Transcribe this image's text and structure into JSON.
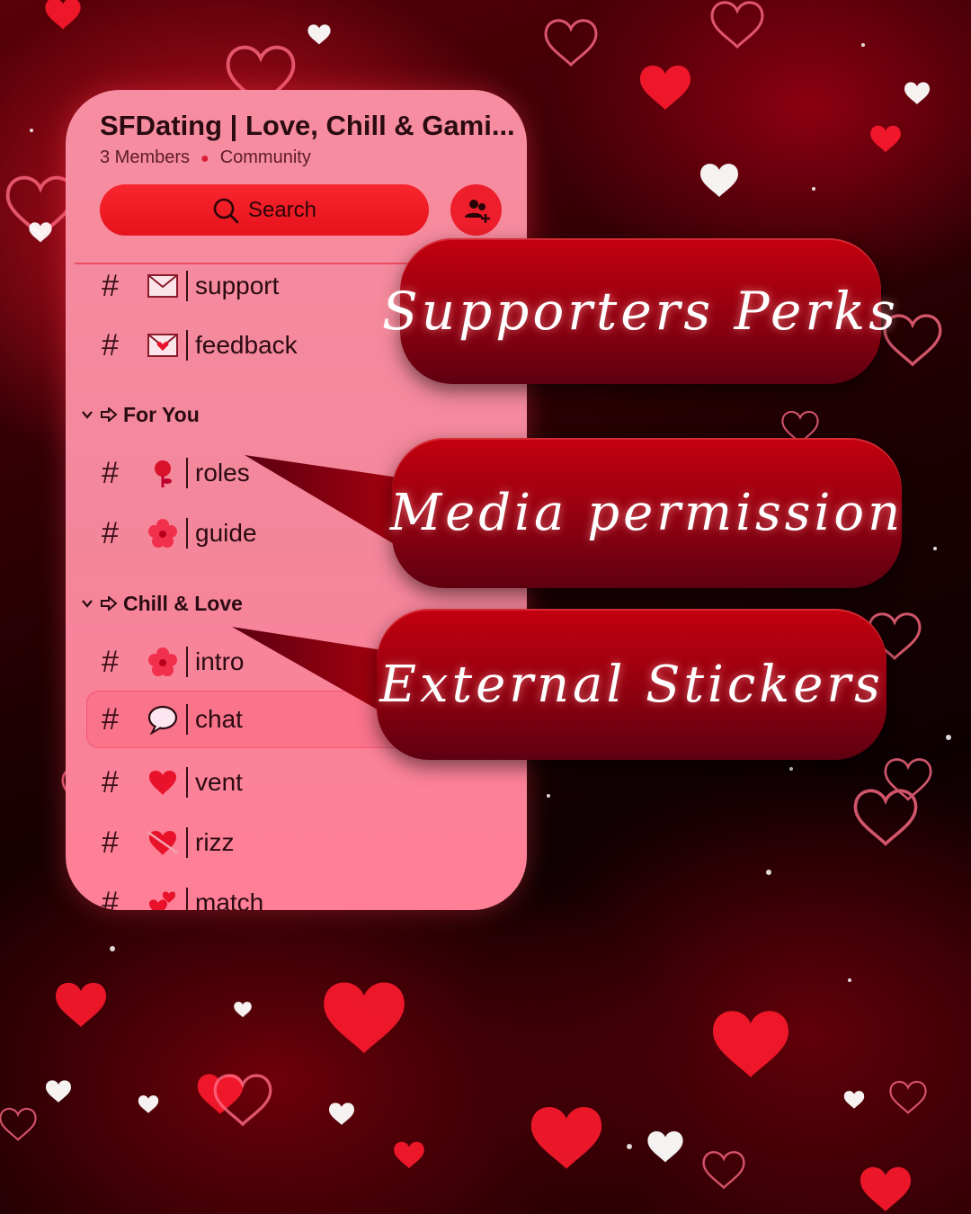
{
  "server": {
    "name": "SFDating | Love, Chill & Gami...",
    "members": "3 Members",
    "type": "Community"
  },
  "search": {
    "label": "Search",
    "icon": "search-icon"
  },
  "invite": {
    "icon": "add-member-icon"
  },
  "channels_top": [
    {
      "label": "support",
      "emoji": "envelope-icon"
    },
    {
      "label": "feedback",
      "emoji": "love-letter-icon"
    }
  ],
  "categories": [
    {
      "name": "For You",
      "channels": [
        {
          "label": "roles",
          "emoji": "rose-icon"
        },
        {
          "label": "guide",
          "emoji": "flower-icon"
        }
      ]
    },
    {
      "name": "Chill & Love",
      "channels": [
        {
          "label": "intro",
          "emoji": "flower-icon"
        },
        {
          "label": "chat",
          "emoji": "speech-bubble-icon",
          "selected": true
        },
        {
          "label": "vent",
          "emoji": "heart-icon"
        },
        {
          "label": "rizz",
          "emoji": "heart-arrow-icon"
        },
        {
          "label": "match",
          "emoji": "two-hearts-icon"
        }
      ]
    }
  ],
  "callouts": [
    "Supporters Perks",
    "Media permission",
    "External Stickers"
  ],
  "colors": {
    "panel": "#f78da0",
    "accent": "#ee1e2c",
    "callout": "#9a0010"
  }
}
